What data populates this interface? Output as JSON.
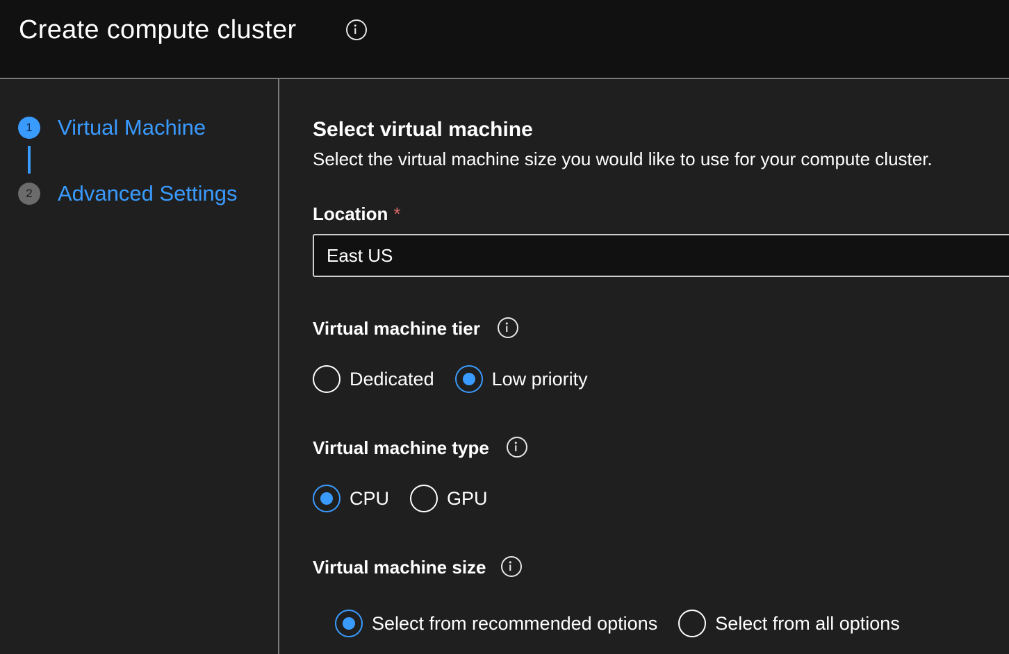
{
  "header": {
    "title": "Create compute cluster",
    "info_icon": "info-icon"
  },
  "steps": [
    {
      "number": "1",
      "label": "Virtual Machine",
      "state": "active"
    },
    {
      "number": "2",
      "label": "Advanced Settings",
      "state": "inactive"
    }
  ],
  "section": {
    "title": "Select virtual machine",
    "description": "Select the virtual machine size you would like to use for your compute cluster."
  },
  "location": {
    "label": "Location",
    "required_marker": "*",
    "value": "East US"
  },
  "vm_tier": {
    "label": "Virtual machine tier",
    "options": [
      {
        "label": "Dedicated",
        "checked": false
      },
      {
        "label": "Low priority",
        "checked": true
      }
    ]
  },
  "vm_type": {
    "label": "Virtual machine type",
    "options": [
      {
        "label": "CPU",
        "checked": true
      },
      {
        "label": "GPU",
        "checked": false
      }
    ]
  },
  "vm_size": {
    "label": "Virtual machine size",
    "options": [
      {
        "label": "Select from recommended options",
        "checked": true
      },
      {
        "label": "Select from all options",
        "checked": false
      }
    ]
  },
  "colors": {
    "accent": "#3a9bff",
    "header_background": "#111111",
    "page_background": "#1f1f1f",
    "required": "#e06a6a"
  }
}
